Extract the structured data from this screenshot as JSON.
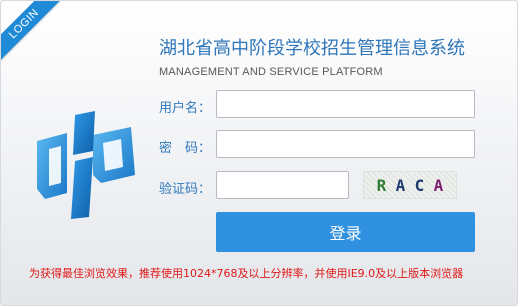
{
  "corner_tag": "LOGIN",
  "header": {
    "title": "湖北省高中阶段学校招生管理信息系统",
    "subtitle": "MANAGEMENT AND SERVICE PLATFORM"
  },
  "form": {
    "username_label": "用户名：",
    "username_value": "",
    "password_label": "密　码：",
    "password_value": "",
    "captcha_label": "验证码：",
    "captcha_value": "",
    "captcha_chars": [
      {
        "char": "R",
        "color": "#2e7d32"
      },
      {
        "char": "A",
        "color": "#1f3a6e"
      },
      {
        "char": "C",
        "color": "#1f3a6e"
      },
      {
        "char": "A",
        "color": "#7b1e6e"
      }
    ],
    "login_button": "登录"
  },
  "notice": "为获得最佳浏览效果，推荐使用1024*768及以上分辨率，并使用IE9.0及以上版本浏览器",
  "colors": {
    "accent": "#2f91df",
    "title": "#2f76b9",
    "label": "#2e79be",
    "notice": "#e01818"
  }
}
